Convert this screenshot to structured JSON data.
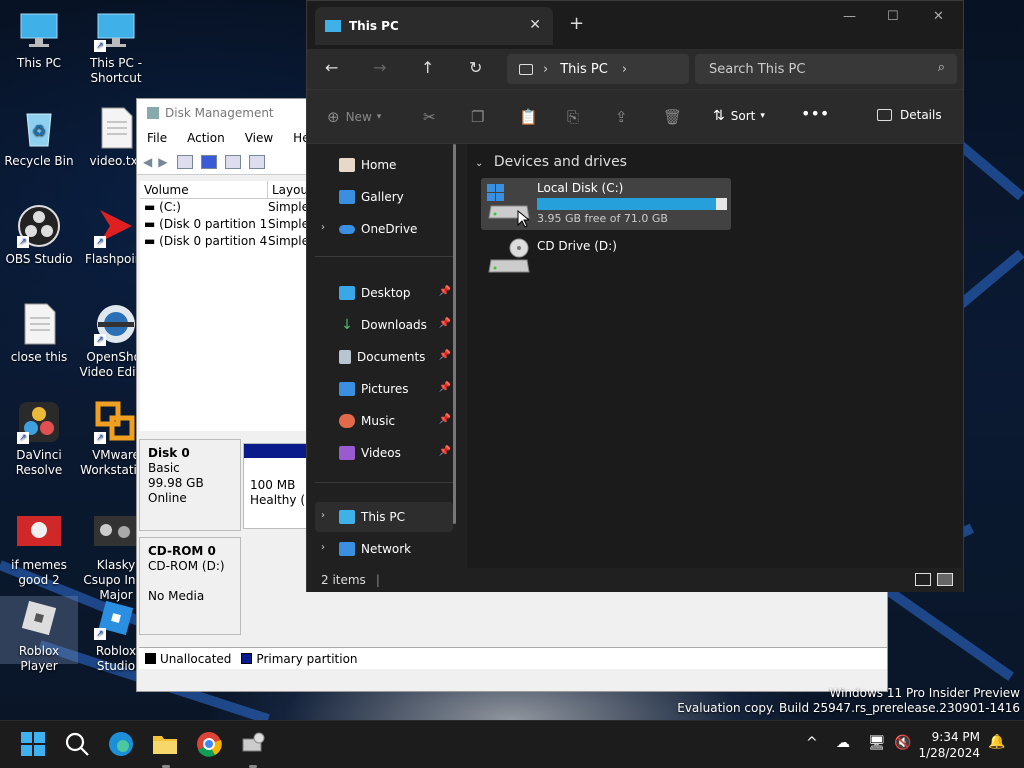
{
  "desktop": {
    "icons": [
      {
        "label": "This PC"
      },
      {
        "label": "This PC - Shortcut"
      },
      {
        "label": "Recycle Bin"
      },
      {
        "label": "video.txt"
      },
      {
        "label": "OBS Studio"
      },
      {
        "label": "Flashpoint"
      },
      {
        "label": "close this"
      },
      {
        "label": "OpenShot Video Editor"
      },
      {
        "label": "DaVinci Resolve"
      },
      {
        "label": "VMware Workstation"
      },
      {
        "label": "if memes good 2"
      },
      {
        "label": "Klasky Csupo In G Major"
      },
      {
        "label": "Roblox Player"
      },
      {
        "label": "Roblox Studio"
      }
    ]
  },
  "disk_management": {
    "title": "Disk Management",
    "menu": [
      "File",
      "Action",
      "View",
      "Help"
    ],
    "columns": [
      "Volume",
      "Layout"
    ],
    "volumes": [
      {
        "name": "(C:)",
        "layout": "Simple"
      },
      {
        "name": "(Disk 0 partition 1)",
        "layout": "Simple"
      },
      {
        "name": "(Disk 0 partition 4)",
        "layout": "Simple"
      }
    ],
    "disk0": {
      "name": "Disk 0",
      "type": "Basic",
      "size": "99.98 GB",
      "status": "Online",
      "partition_size": "100 MB",
      "partition_status": "Healthy (E"
    },
    "cdrom": {
      "name": "CD-ROM 0",
      "type": "CD-ROM (D:)",
      "status": "No Media"
    },
    "legend": {
      "unallocated": "Unallocated",
      "primary": "Primary partition"
    }
  },
  "explorer": {
    "tab_title": "This PC",
    "address": "This PC",
    "search_placeholder": "Search This PC",
    "commands": {
      "new": "New",
      "sort": "Sort",
      "details": "Details"
    },
    "sidebar": {
      "home": "Home",
      "gallery": "Gallery",
      "onedrive": "OneDrive",
      "desktop": "Desktop",
      "downloads": "Downloads",
      "documents": "Documents",
      "pictures": "Pictures",
      "music": "Music",
      "videos": "Videos",
      "thispc": "This PC",
      "network": "Network"
    },
    "group_heading": "Devices and drives",
    "drives": [
      {
        "name": "Local Disk (C:)",
        "free_text": "3.95 GB free of 71.0 GB",
        "used_fraction": 0.944
      },
      {
        "name": "CD Drive (D:)"
      }
    ],
    "status": "2 items"
  },
  "watermark": {
    "line1": "Windows 11 Pro Insider Preview",
    "line2": "Evaluation copy. Build 25947.rs_prerelease.230901-1416"
  },
  "taskbar": {
    "time": "9:34 PM",
    "date": "1/28/2024"
  },
  "colors": {
    "accent": "#26a0da",
    "explorer_bg": "#202020",
    "content_bg": "#1b1b1b"
  }
}
